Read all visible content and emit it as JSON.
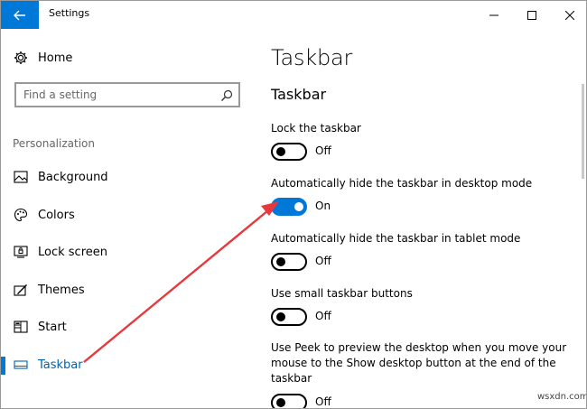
{
  "window": {
    "title": "Settings"
  },
  "sidebar": {
    "home_label": "Home",
    "search_placeholder": "Find a setting",
    "section_heading": "Personalization",
    "items": [
      {
        "label": "Background",
        "icon": "image-icon"
      },
      {
        "label": "Colors",
        "icon": "palette-icon"
      },
      {
        "label": "Lock screen",
        "icon": "lock-screen-icon"
      },
      {
        "label": "Themes",
        "icon": "themes-icon"
      },
      {
        "label": "Start",
        "icon": "start-icon"
      },
      {
        "label": "Taskbar",
        "icon": "taskbar-icon",
        "selected": true
      }
    ]
  },
  "main": {
    "page_title": "Taskbar",
    "section_title": "Taskbar",
    "settings": [
      {
        "label": "Lock the taskbar",
        "state": "Off",
        "on": false
      },
      {
        "label": "Automatically hide the taskbar in desktop mode",
        "state": "On",
        "on": true
      },
      {
        "label": "Automatically hide the taskbar in tablet mode",
        "state": "Off",
        "on": false
      },
      {
        "label": "Use small taskbar buttons",
        "state": "Off",
        "on": false
      },
      {
        "label": "Use Peek to preview the desktop when you move your mouse to the Show desktop button at the end of the taskbar",
        "state": "Off",
        "on": false
      }
    ]
  },
  "colors": {
    "accent": "#0078d7",
    "annotation_arrow": "#e8383d"
  },
  "watermark": "wsxdn.com"
}
